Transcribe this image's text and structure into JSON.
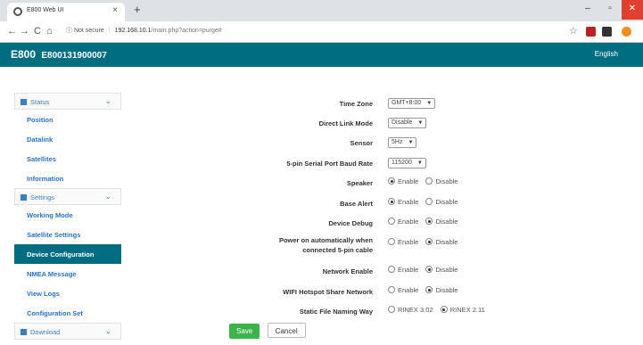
{
  "browser": {
    "tab_title": "E800 Web UI",
    "tab_close": "×",
    "new_tab": "+",
    "nav": {
      "back": "←",
      "forward": "→",
      "reload": "C",
      "home": "⌂"
    },
    "security": "ⓘ Not secure",
    "host": "192.168.10.1",
    "path": "/main.php?action=purge#",
    "window": {
      "minimize": "–",
      "maximize": "▫",
      "close": "✕"
    },
    "star": "☆"
  },
  "header": {
    "model": "E800",
    "serial": "E800131900007",
    "language": "English"
  },
  "sidebar": {
    "groups": [
      {
        "label": "Status",
        "icon": "grid-icon"
      },
      {
        "label": "Settings",
        "icon": "gear-icon"
      },
      {
        "label": "Download",
        "icon": "download-icon"
      }
    ],
    "status_items": [
      "Position",
      "Datalink",
      "Satellites",
      "Information"
    ],
    "settings_items": [
      "Working Mode",
      "Satellite Settings",
      "Device Configuration",
      "NMEA Message",
      "View Logs",
      "Configuration Set"
    ],
    "active_item": "Device Configuration",
    "chevron": "⌄"
  },
  "form": {
    "time_zone": {
      "label": "Time Zone",
      "value": "GMT+8:00"
    },
    "direct_link_mode": {
      "label": "Direct Link Mode",
      "value": "Disable"
    },
    "sensor": {
      "label": "Sensor",
      "value": "5Hz"
    },
    "baud_rate": {
      "label": "5-pin Serial Port Baud Rate",
      "value": "115200"
    },
    "speaker": {
      "label": "Speaker",
      "opt1": "Enable",
      "opt2": "Disable",
      "selected": "Enable"
    },
    "base_alert": {
      "label": "Base Alert",
      "opt1": "Enable",
      "opt2": "Disable",
      "selected": "Enable"
    },
    "device_debug": {
      "label": "Device Debug",
      "opt1": "Enable",
      "opt2": "Disable",
      "selected": "Disable"
    },
    "power_on": {
      "label": "Power on automatically when connected 5-pin cable",
      "opt1": "Enable",
      "opt2": "Disable",
      "selected": "Disable"
    },
    "network_enable": {
      "label": "Network Enable",
      "opt1": "Enable",
      "opt2": "Disable",
      "selected": "Disable"
    },
    "wifi_hotspot": {
      "label": "WIFI Hotspot Share Network",
      "opt1": "Enable",
      "opt2": "Disable",
      "selected": "Disable"
    },
    "static_naming": {
      "label": "Static File Naming Way",
      "opt1": "RINEX 3.02",
      "opt2": "RINEX 2.11",
      "selected": "RINEX 2.11"
    }
  },
  "buttons": {
    "save": "Save",
    "cancel": "Cancel"
  },
  "colors": {
    "header": "#006e80",
    "link": "#2a73c5",
    "save": "#3cb44b",
    "close": "#e04030"
  }
}
